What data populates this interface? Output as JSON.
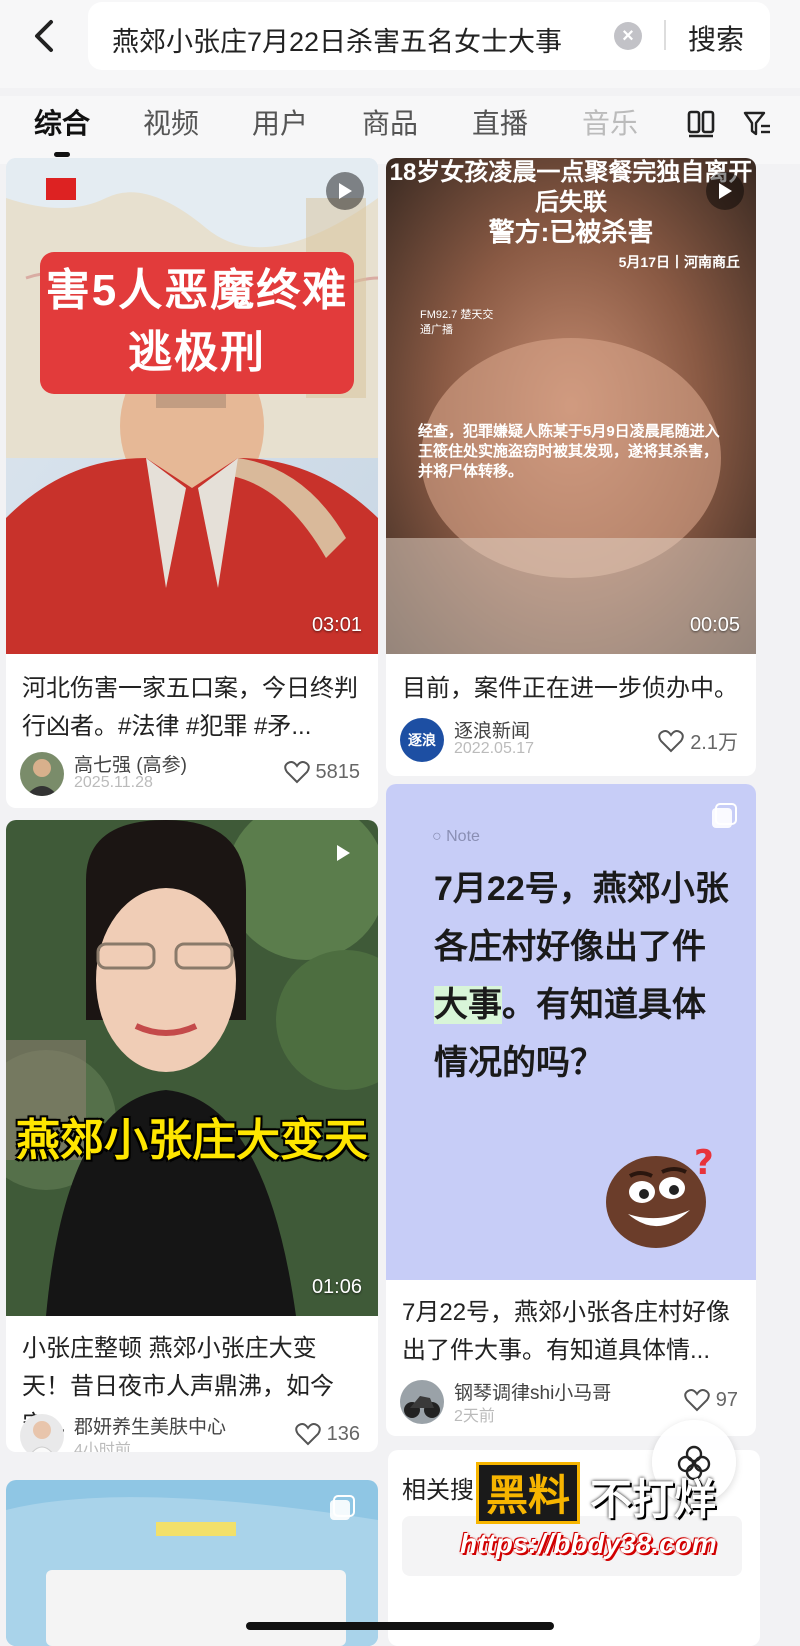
{
  "search": {
    "query": "燕郊小张庄7月22日杀害五名女士大事",
    "button": "搜索"
  },
  "tabs": [
    {
      "label": "综合"
    },
    {
      "label": "视频"
    },
    {
      "label": "用户"
    },
    {
      "label": "商品"
    },
    {
      "label": "直播"
    },
    {
      "label": "音乐"
    }
  ],
  "cards": [
    {
      "overlay": "害5人恶魔终难逃极刑",
      "duration": "03:01",
      "title": "河北伤害一家五口案，今日终判行凶者。#法律 #犯罪 #矛...",
      "author": "高七强 (高参)",
      "date": "2025.11.28",
      "likes": "5815"
    },
    {
      "overlay_title": "18岁女孩凌晨一点聚餐完独自离开后失联",
      "overlay_sub": "警方:已被杀害",
      "overlay_meta": "5月17日丨河南商丘",
      "overlay_source": "FM92.7 楚天交通广播",
      "overlay_caption": "经查，犯罪嫌疑人陈某于5月9日凌晨尾随进入王筱住处实施盗窃时被其发现，遂将其杀害，并将尸体转移。",
      "duration": "00:05",
      "title": "目前，案件正在进一步侦办中。",
      "author": "逐浪新闻",
      "avatar_text": "逐浪",
      "date": "2022.05.17",
      "likes": "2.1万"
    },
    {
      "overlay": "燕郊小张庄大变天",
      "duration": "01:06",
      "title": "小张庄整顿 燕郊小张庄大变天！昔日夜市人声鼎沸，如今安...",
      "author": "郡妍养生美肤中心",
      "date": "4小时前",
      "likes": "136"
    },
    {
      "note_label": "Note",
      "note_text": "7月22号，燕郊小张各庄村好像出了件大事。有知道具体情况的吗？",
      "note_pre": "7月22号，燕郊小张各庄村好像出了件",
      "note_hl1": "大",
      "note_hl2": "事",
      "note_post": "。有知道具体情况的吗？",
      "title": "7月22号，燕郊小张各庄村好像出了件大事。有知道具体情...",
      "author": "钢琴调律shi小马哥",
      "date": "2天前",
      "likes": "97"
    }
  ],
  "related": {
    "title": "相关搜"
  },
  "watermark": {
    "black": "黑料",
    "white": "不打烊",
    "url": "https://bbdy38.com"
  },
  "colors": {
    "accent": "#111111",
    "note_bg": "#c7cdf7",
    "red_box": "#e23b3b",
    "yellow_title": "#ffe600"
  }
}
